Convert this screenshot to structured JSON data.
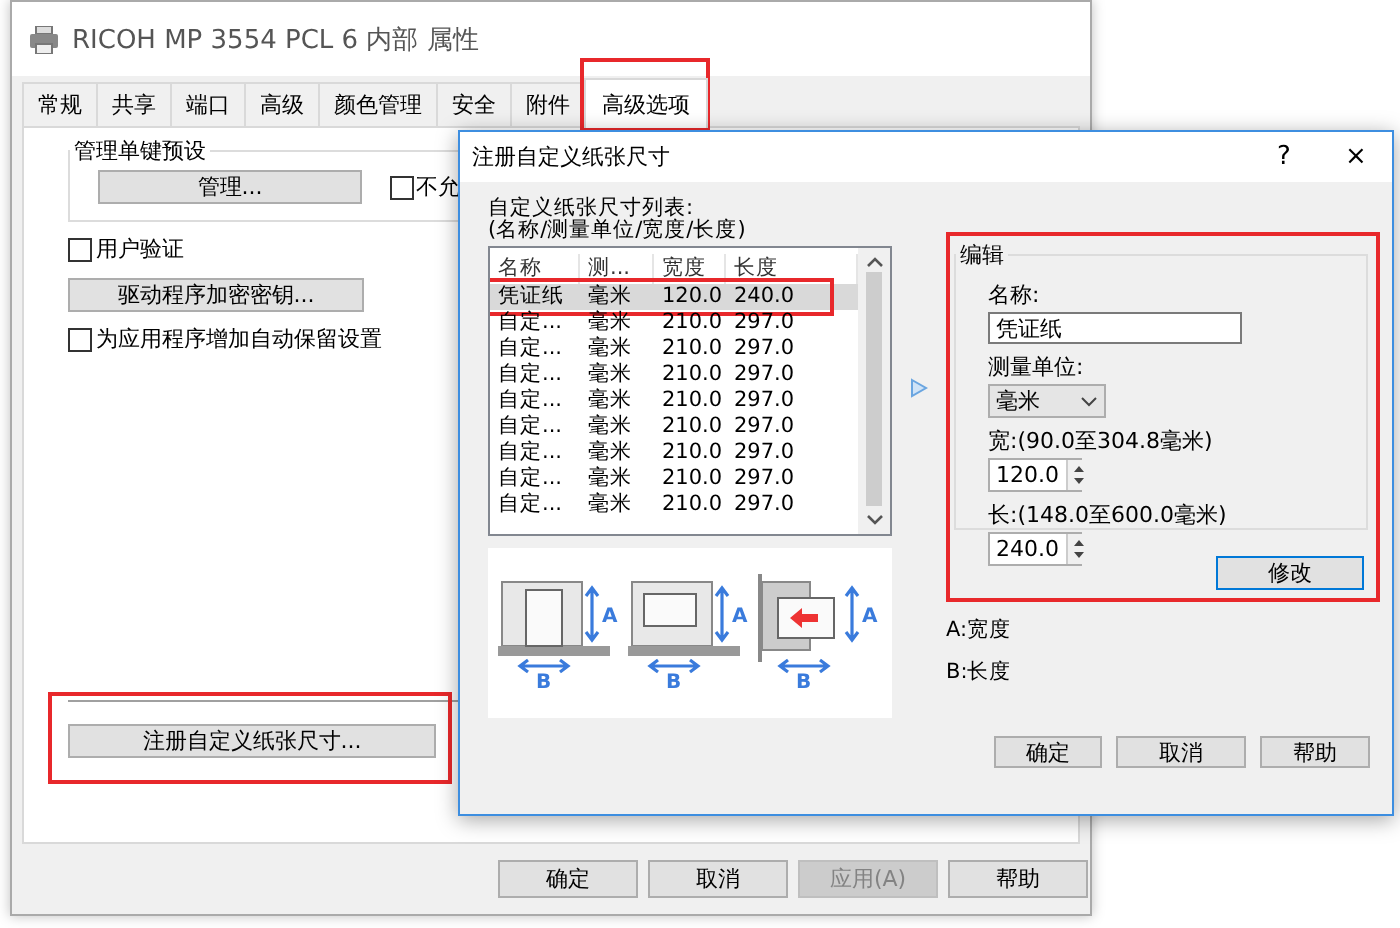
{
  "main_window": {
    "title": "RICOH MP 3554 PCL 6 内部 属性",
    "tabs": [
      {
        "label": "常规",
        "selected": false,
        "highlighted": false
      },
      {
        "label": "共享",
        "selected": false,
        "highlighted": false
      },
      {
        "label": "端口",
        "selected": false,
        "highlighted": false
      },
      {
        "label": "高级",
        "selected": false,
        "highlighted": false
      },
      {
        "label": "颜色管理",
        "selected": false,
        "highlighted": false
      },
      {
        "label": "安全",
        "selected": false,
        "highlighted": false
      },
      {
        "label": "附件",
        "selected": false,
        "highlighted": false
      },
      {
        "label": "高级选项",
        "selected": true,
        "highlighted": true
      }
    ],
    "preset_group": {
      "title": "管理单键预设",
      "manage_button": "管理...",
      "checkbox": {
        "label": "不允",
        "checked": false
      }
    },
    "user_auth": {
      "label": "用户验证",
      "checked": false
    },
    "encryption_button": "驱动程序加密密钥...",
    "auto_keep": {
      "label": "为应用程序增加自动保留设置",
      "checked": false
    },
    "register_button": {
      "label": "注册自定义纸张尺寸...",
      "highlighted": true
    },
    "buttons": [
      {
        "label": "确定",
        "disabled": false
      },
      {
        "label": "取消",
        "disabled": false
      },
      {
        "label": "应用(A)",
        "disabled": true
      },
      {
        "label": "帮助",
        "disabled": false
      }
    ]
  },
  "dialog": {
    "title": "注册自定义纸张尺寸",
    "help_button": "?",
    "close_button": "×",
    "list_label": [
      "自定义纸张尺寸列表:",
      "(名称/测量单位/宽度/长度)"
    ],
    "columns": [
      "名称",
      "测...",
      "宽度",
      "长度"
    ],
    "rows": [
      {
        "cells": [
          "凭证纸",
          "毫米",
          "120.0",
          "240.0"
        ],
        "selected": true,
        "highlighted": true
      },
      {
        "cells": [
          "自定...",
          "毫米",
          "210.0",
          "297.0"
        ],
        "selected": false,
        "highlighted": false
      },
      {
        "cells": [
          "自定...",
          "毫米",
          "210.0",
          "297.0"
        ],
        "selected": false,
        "highlighted": false
      },
      {
        "cells": [
          "自定...",
          "毫米",
          "210.0",
          "297.0"
        ],
        "selected": false,
        "highlighted": false
      },
      {
        "cells": [
          "自定...",
          "毫米",
          "210.0",
          "297.0"
        ],
        "selected": false,
        "highlighted": false
      },
      {
        "cells": [
          "自定...",
          "毫米",
          "210.0",
          "297.0"
        ],
        "selected": false,
        "highlighted": false
      },
      {
        "cells": [
          "自定...",
          "毫米",
          "210.0",
          "297.0"
        ],
        "selected": false,
        "highlighted": false
      },
      {
        "cells": [
          "自定...",
          "毫米",
          "210.0",
          "297.0"
        ],
        "selected": false,
        "highlighted": false
      },
      {
        "cells": [
          "自定...",
          "毫米",
          "210.0",
          "297.0"
        ],
        "selected": false,
        "highlighted": false
      }
    ],
    "illustrations": [
      {
        "kind": "portrait",
        "width_mark": "A",
        "length_mark": "B"
      },
      {
        "kind": "landscape",
        "width_mark": "A",
        "length_mark": "B"
      },
      {
        "kind": "bypass",
        "width_mark": "A",
        "length_mark": "B"
      }
    ],
    "edit_group": {
      "title": "编辑",
      "highlighted": true,
      "name_label": "名称:",
      "name_value": "凭证纸",
      "unit_label": "测量单位:",
      "unit_value": "毫米",
      "width_label": "宽:(90.0至304.8毫米)",
      "width_value": "120.0",
      "length_label": "长:(148.0至600.0毫米)",
      "length_value": "240.0",
      "modify_button": "修改"
    },
    "legend": [
      "A:宽度",
      "B:长度"
    ],
    "buttons": [
      "确定",
      "取消",
      "帮助"
    ]
  }
}
